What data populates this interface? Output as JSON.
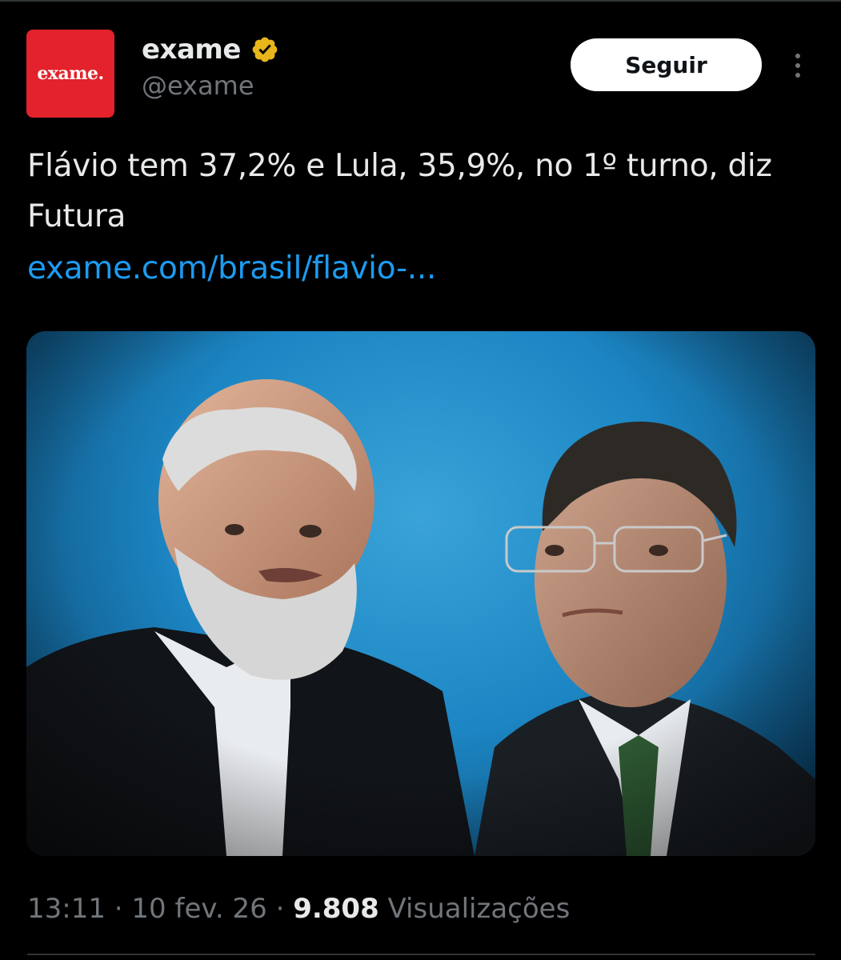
{
  "account": {
    "avatar_text": "exame.",
    "display_name": "exame",
    "handle": "@exame",
    "verified_icon": "gold-verified-badge-icon"
  },
  "follow_label": "Seguir",
  "more_icon": "more-vertical-icon",
  "tweet": {
    "text": "Flávio tem 37,2% e Lula, 35,9%, no 1º turno, diz Futura",
    "link": "exame.com/brasil/flavio-..."
  },
  "meta": {
    "time": "13:11",
    "date": "10 fev. 26",
    "views_count": "9.808",
    "views_label": "Visualizações",
    "separator": "·"
  },
  "colors": {
    "brand_red": "#e3222b",
    "link_blue": "#1d9bf0",
    "verified_gold": "#e8b51a",
    "muted_text": "#71767b"
  }
}
